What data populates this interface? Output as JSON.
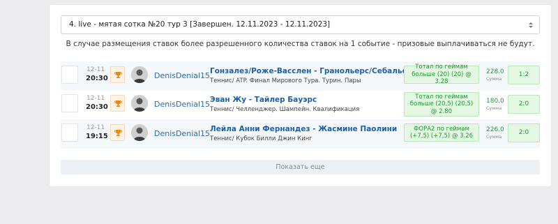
{
  "tournament_select": {
    "value": "4. live - мятая сотка №20 тур 3   [Завершен.  12.11.2023 - 12.11.2023]"
  },
  "notice": "В случае размещения ставок более разрешенного количества ставок на 1 событие - призовые выплачиваться не будут.",
  "bets": [
    {
      "date": "12-11",
      "time": "20:30",
      "user": "DenisDenial15",
      "event": "Гонзалез/Роже-Васслен - Гранольерс/Себальос",
      "league": "Теннис/ ATP. Финал Мирового Тура. Турин. Пары",
      "bet": "Тотал по геймам больше (20) (20) @ 3.28",
      "amount": "228.0",
      "amount_label": "Сумма",
      "score": "1:2"
    },
    {
      "date": "12-11",
      "time": "20:30",
      "user": "DenisDenial15",
      "event": "Эван Жу - Тайлер Бауэрс",
      "league": "Теннис/ Челленджер. Шампейн. Квалификация",
      "bet": "Тотал по геймам больше (20,5) (20,5) @ 2.80",
      "amount": "180.0",
      "amount_label": "Сумма",
      "score": "2:0"
    },
    {
      "date": "12-11",
      "time": "19:15",
      "user": "DenisDenial15",
      "event": "Лейла Анни Фернандез - Жасмине Паолини",
      "league": "Теннис/ Кубок Билли Джин Кинг",
      "bet": "ФОРА2 по геймам (+7,5) (+7,5) @ 3.26",
      "amount": "226.0",
      "amount_label": "Сумма",
      "score": "2:0"
    }
  ],
  "show_more": "Показать еще",
  "colors": {
    "accent_link": "#1d5fa6",
    "win_green": "#1a9a2a",
    "win_bg": "#e3f7e3",
    "trophy": "#e08a1e"
  }
}
